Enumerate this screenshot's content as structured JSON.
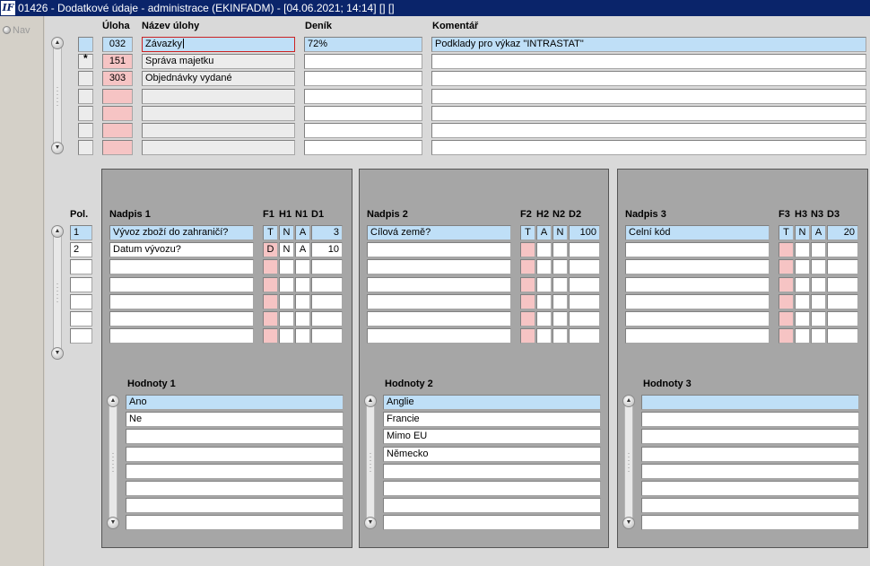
{
  "window": {
    "title": "01426 - Dodatkové údaje - administrace (EKINFADM) - [04.06.2021; 14:14]  [] []",
    "icon_label": "IF"
  },
  "nav": {
    "label": "Nav"
  },
  "top": {
    "headers": {
      "uloha": "Úloha",
      "nazev": "Název úlohy",
      "denik": "Deník",
      "komentar": "Komentář"
    },
    "rows": [
      {
        "marker": "",
        "uloha": "032",
        "nazev": "Závazky",
        "denik": "72%",
        "komentar": "Podklady pro výkaz \"INTRASTAT\""
      },
      {
        "marker": "*",
        "uloha": "151",
        "nazev": "Správa majetku",
        "denik": "",
        "komentar": ""
      },
      {
        "marker": "",
        "uloha": "303",
        "nazev": "Objednávky vydané",
        "denik": "",
        "komentar": ""
      },
      {
        "marker": "",
        "uloha": "",
        "nazev": "",
        "denik": "",
        "komentar": ""
      },
      {
        "marker": "",
        "uloha": "",
        "nazev": "",
        "denik": "",
        "komentar": ""
      },
      {
        "marker": "",
        "uloha": "",
        "nazev": "",
        "denik": "",
        "komentar": ""
      },
      {
        "marker": "",
        "uloha": "",
        "nazev": "",
        "denik": "",
        "komentar": ""
      }
    ]
  },
  "pol": {
    "header": "Pol.",
    "values": [
      "1",
      "2",
      "",
      "",
      "",
      "",
      ""
    ]
  },
  "panels": [
    {
      "nadpis_header": "Nadpis 1",
      "f": "F1",
      "h": "H1",
      "n": "N1",
      "d": "D1",
      "rows": [
        {
          "nadpis": "Vývoz zboží do zahraničí?",
          "f": "T",
          "h": "N",
          "n": "A",
          "d": "3"
        },
        {
          "nadpis": "Datum vývozu?",
          "f": "D",
          "h": "N",
          "n": "A",
          "d": "10"
        },
        {
          "nadpis": "",
          "f": "",
          "h": "",
          "n": "",
          "d": ""
        },
        {
          "nadpis": "",
          "f": "",
          "h": "",
          "n": "",
          "d": ""
        },
        {
          "nadpis": "",
          "f": "",
          "h": "",
          "n": "",
          "d": ""
        },
        {
          "nadpis": "",
          "f": "",
          "h": "",
          "n": "",
          "d": ""
        },
        {
          "nadpis": "",
          "f": "",
          "h": "",
          "n": "",
          "d": ""
        }
      ],
      "hodnoty_header": "Hodnoty 1",
      "hodnoty": [
        "Ano",
        "Ne",
        "",
        "",
        "",
        "",
        "",
        ""
      ]
    },
    {
      "nadpis_header": "Nadpis 2",
      "f": "F2",
      "h": "H2",
      "n": "N2",
      "d": "D2",
      "rows": [
        {
          "nadpis": "Cílová země?",
          "f": "T",
          "h": "A",
          "n": "N",
          "d": "100"
        },
        {
          "nadpis": "",
          "f": "",
          "h": "",
          "n": "",
          "d": ""
        },
        {
          "nadpis": "",
          "f": "",
          "h": "",
          "n": "",
          "d": ""
        },
        {
          "nadpis": "",
          "f": "",
          "h": "",
          "n": "",
          "d": ""
        },
        {
          "nadpis": "",
          "f": "",
          "h": "",
          "n": "",
          "d": ""
        },
        {
          "nadpis": "",
          "f": "",
          "h": "",
          "n": "",
          "d": ""
        },
        {
          "nadpis": "",
          "f": "",
          "h": "",
          "n": "",
          "d": ""
        }
      ],
      "hodnoty_header": "Hodnoty 2",
      "hodnoty": [
        "Anglie",
        "Francie",
        "Mimo EU",
        "Německo",
        "",
        "",
        "",
        ""
      ]
    },
    {
      "nadpis_header": "Nadpis 3",
      "f": "F3",
      "h": "H3",
      "n": "N3",
      "d": "D3",
      "rows": [
        {
          "nadpis": "Celní kód",
          "f": "T",
          "h": "N",
          "n": "A",
          "d": "20"
        },
        {
          "nadpis": "",
          "f": "",
          "h": "",
          "n": "",
          "d": ""
        },
        {
          "nadpis": "",
          "f": "",
          "h": "",
          "n": "",
          "d": ""
        },
        {
          "nadpis": "",
          "f": "",
          "h": "",
          "n": "",
          "d": ""
        },
        {
          "nadpis": "",
          "f": "",
          "h": "",
          "n": "",
          "d": ""
        },
        {
          "nadpis": "",
          "f": "",
          "h": "",
          "n": "",
          "d": ""
        },
        {
          "nadpis": "",
          "f": "",
          "h": "",
          "n": "",
          "d": ""
        }
      ],
      "hodnoty_header": "Hodnoty 3",
      "hodnoty": [
        "",
        "",
        "",
        "",
        "",
        "",
        "",
        ""
      ]
    }
  ],
  "colors": {
    "selected_row": "#bfdff7",
    "required_field": "#f6c4c4",
    "title_bar": "#0a246a",
    "focus_border": "#cc2222"
  }
}
